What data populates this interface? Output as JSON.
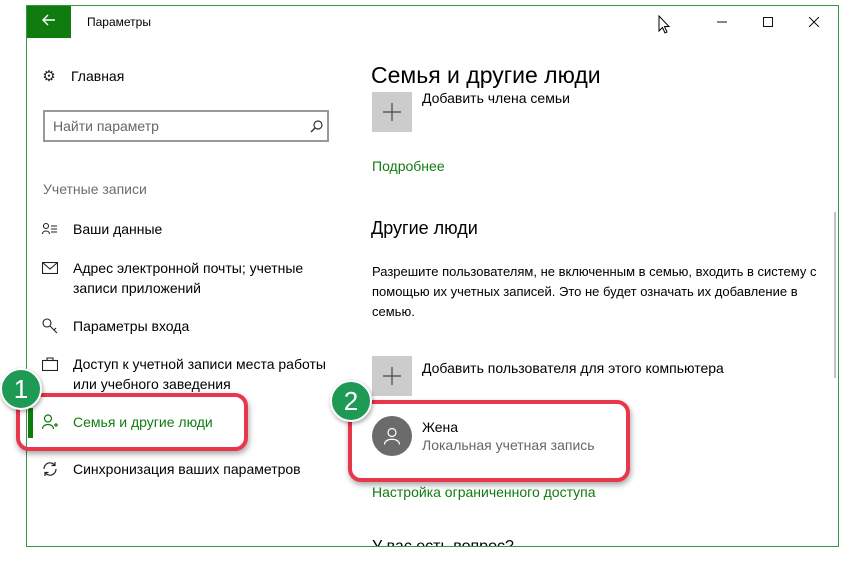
{
  "window": {
    "title": "Параметры",
    "controls": {
      "minimize": "—",
      "maximize": "☐",
      "close": "✕"
    }
  },
  "sidebar": {
    "home_label": "Главная",
    "search": {
      "placeholder": "Найти параметр"
    },
    "section_heading": "Учетные записи",
    "items": [
      {
        "label": "Ваши данные",
        "icon": "user-card-icon"
      },
      {
        "label": "Адрес электронной почты; учетные записи приложений",
        "icon": "mail-icon"
      },
      {
        "label": "Параметры входа",
        "icon": "key-icon"
      },
      {
        "label": "Доступ к учетной записи места работы или учебного заведения",
        "icon": "briefcase-icon"
      },
      {
        "label": "Семья и другие люди",
        "icon": "person-add-icon",
        "active": true
      },
      {
        "label": "Синхронизация ваших параметров",
        "icon": "sync-icon"
      }
    ]
  },
  "main": {
    "title": "Семья и другие люди",
    "add_family_label": "Добавить члена семьи",
    "more_link": "Подробнее",
    "other_people": {
      "heading": "Другие люди",
      "description": "Разрешите пользователям, не включенным в семью, входить в систему с помощью их учетных записей. Это не будет означать их добавление в семью.",
      "add_user_label": "Добавить пользователя для этого компьютера",
      "user": {
        "name": "Жена",
        "account_type": "Локальная учетная запись"
      },
      "assigned_access_link": "Настройка ограниченного доступа"
    },
    "cut_off_heading": "У вас есть вопрос?"
  },
  "annotations": {
    "badge_1": "1",
    "badge_2": "2",
    "color": "#e8364a",
    "badge_color": "#1f9a55"
  },
  "colors": {
    "accent": "#107c10",
    "window_border": "#2f9a44"
  }
}
